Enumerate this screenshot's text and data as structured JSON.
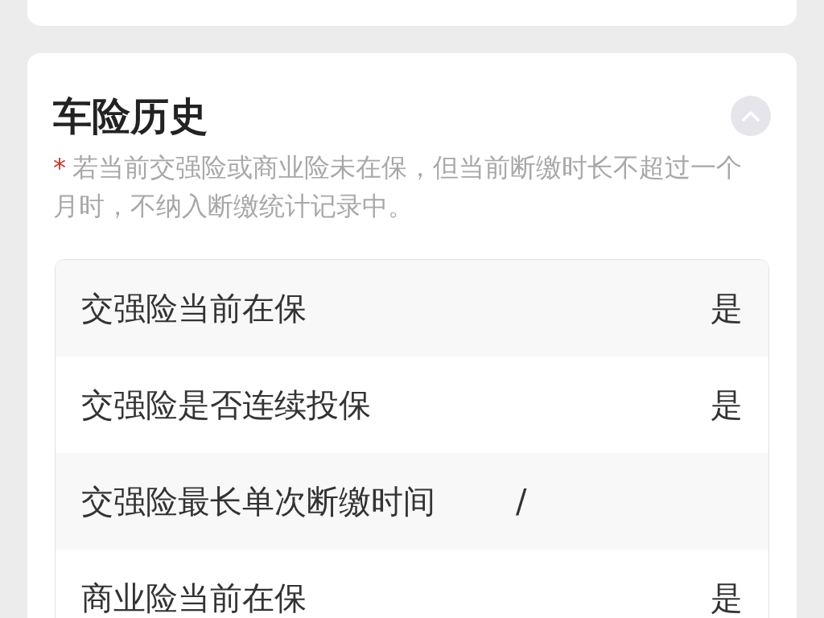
{
  "section": {
    "title": "车险历史",
    "expanded": true,
    "note": {
      "mark": "*",
      "text": "若当前交强险或商业险未在保，但当前断缴时长不超过一个月时，不纳入断缴统计记录中。"
    }
  },
  "rows": [
    {
      "label": "交强险当前在保",
      "value": "是",
      "kind": "text"
    },
    {
      "label": "交强险是否连续投保",
      "value": "是",
      "kind": "text"
    },
    {
      "label": "交强险最长单次断缴时间",
      "value": "/",
      "kind": "empty"
    },
    {
      "label": "商业险当前在保",
      "value": "是",
      "kind": "text"
    }
  ]
}
